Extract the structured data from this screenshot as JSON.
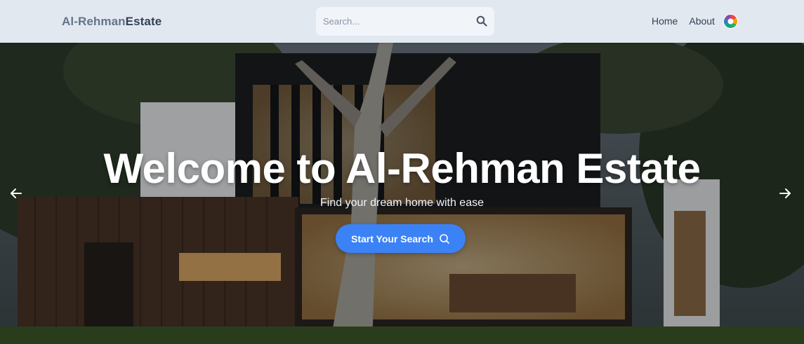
{
  "brand": {
    "part1": "Al-Rehman",
    "part2": "Estate"
  },
  "search": {
    "placeholder": "Search...",
    "icon": "search-icon"
  },
  "nav": {
    "links": [
      "Home",
      "About"
    ],
    "avatar_icon": "profile-avatar-icon"
  },
  "hero": {
    "title": "Welcome to Al-Rehman Estate",
    "subtitle": "Find your dream home with ease",
    "cta_label": "Start Your Search",
    "cta_icon": "search-icon",
    "prev_icon": "arrow-left-icon",
    "next_icon": "arrow-right-icon"
  },
  "colors": {
    "navbar": "#e2e8f0",
    "accent": "#3b82f6",
    "logo_light": "#64748b",
    "logo_dark": "#334155"
  }
}
